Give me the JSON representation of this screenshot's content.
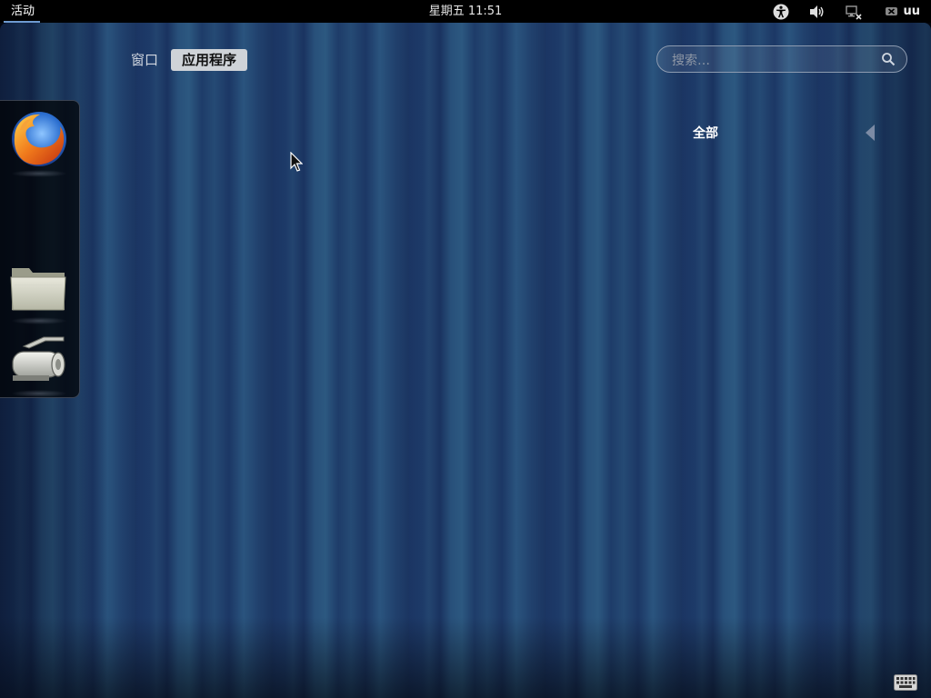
{
  "topbar": {
    "activities_label": "活动",
    "clock": "星期五 11:51",
    "username": "uu",
    "tray_icons": [
      "accessibility-icon",
      "volume-icon",
      "network-disconnected-icon",
      "messaging-offline-icon"
    ]
  },
  "overview": {
    "view_tabs": [
      {
        "label": "窗口",
        "active": false
      },
      {
        "label": "应用程序",
        "active": true
      }
    ],
    "search": {
      "placeholder": "搜索…",
      "value": ""
    },
    "category": {
      "label": "全部"
    }
  },
  "dash": {
    "favorites": [
      {
        "icon": "firefox-icon"
      },
      {
        "icon": "files-folder-icon"
      },
      {
        "icon": "scanner-icon"
      }
    ]
  },
  "colors": {
    "topbar_bg": "#000000",
    "overview_bg": "#1d3a68",
    "accent_underline": "#6e9ad0",
    "active_tab_bg": "#cfd3d8"
  }
}
